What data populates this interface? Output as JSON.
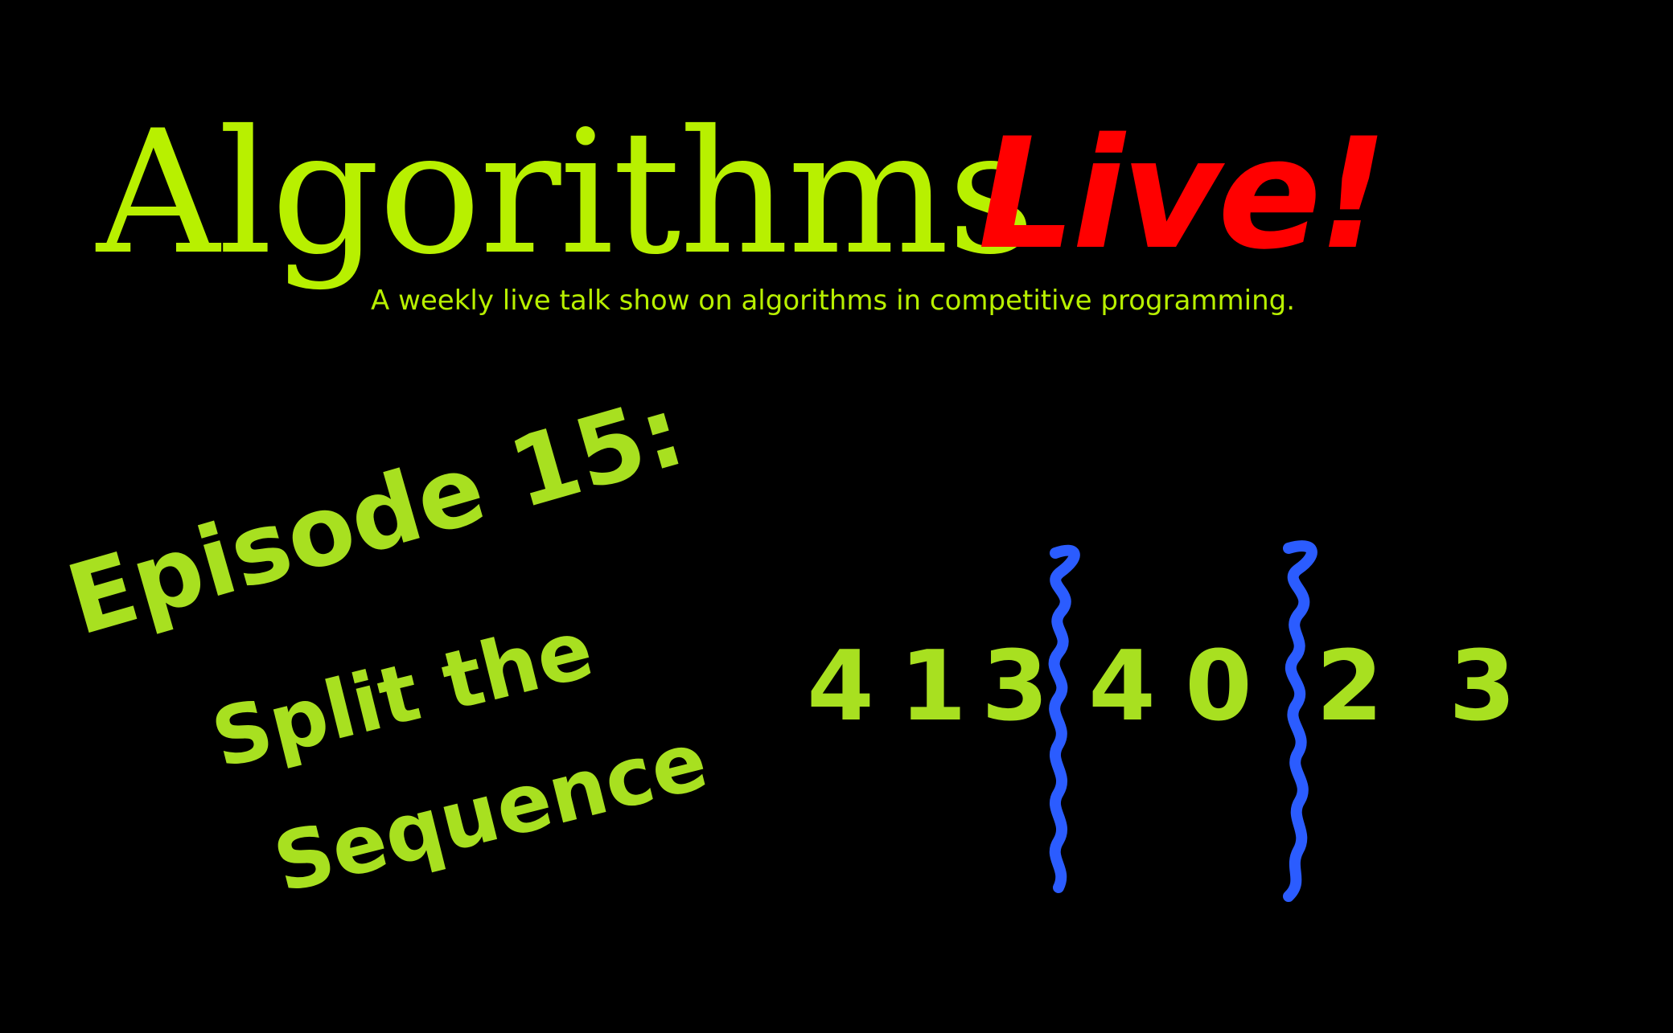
{
  "colors": {
    "background": "#000000",
    "title": "#b8f000",
    "accent": "#ff0000",
    "handwriting": "#a8e020",
    "divider": "#2b5cff"
  },
  "header": {
    "title": "Algorithms",
    "title_accent": "Live!",
    "tagline": "A weekly live talk show on algorithms in competitive programming."
  },
  "episode": {
    "label": "Episode 15:",
    "name_line1": "Split the",
    "name_line2": "Sequence"
  },
  "sequence": {
    "digits": [
      "4",
      "1",
      "3",
      "4",
      "0",
      "2",
      "3"
    ],
    "divider_icon": "wavy-line-icon"
  }
}
